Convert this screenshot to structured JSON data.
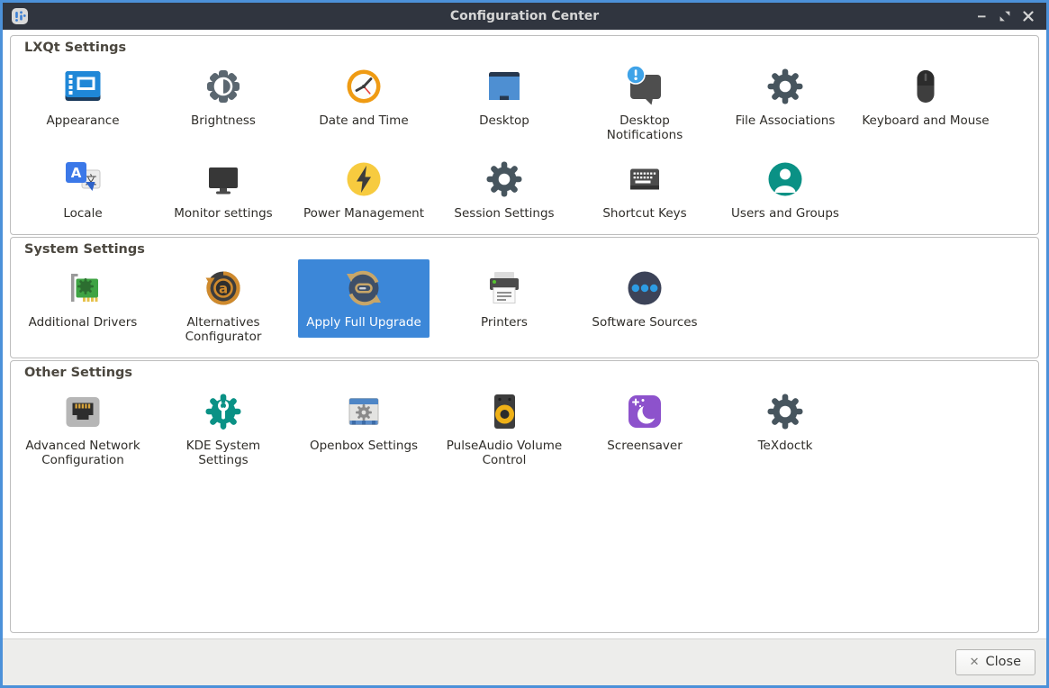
{
  "window": {
    "title": "Configuration Center",
    "app_icon": "configuration-center-icon",
    "controls": [
      {
        "name": "minimize-button",
        "icon": "minimize-icon"
      },
      {
        "name": "maximize-button",
        "icon": "maximize-icon"
      },
      {
        "name": "close-window-button",
        "icon": "close-icon"
      }
    ]
  },
  "sections": [
    {
      "title": "LXQt Settings",
      "items": [
        {
          "label": "Appearance",
          "icon": "appearance-icon",
          "selected": false
        },
        {
          "label": "Brightness",
          "icon": "brightness-icon",
          "selected": false
        },
        {
          "label": "Date and Time",
          "icon": "clock-icon",
          "selected": false
        },
        {
          "label": "Desktop",
          "icon": "desktop-icon",
          "selected": false
        },
        {
          "label": "Desktop Notifications",
          "icon": "notification-bubble-icon",
          "selected": false
        },
        {
          "label": "File Associations",
          "icon": "gear-icon",
          "selected": false
        },
        {
          "label": "Keyboard and Mouse",
          "icon": "mouse-icon",
          "selected": false
        },
        {
          "label": "Locale",
          "icon": "translate-icon",
          "selected": false
        },
        {
          "label": "Monitor settings",
          "icon": "monitor-icon",
          "selected": false
        },
        {
          "label": "Power Management",
          "icon": "power-bolt-icon",
          "selected": false
        },
        {
          "label": "Session Settings",
          "icon": "gear-icon",
          "selected": false
        },
        {
          "label": "Shortcut Keys",
          "icon": "keyboard-icon",
          "selected": false
        },
        {
          "label": "Users and Groups",
          "icon": "user-circle-icon",
          "selected": false
        }
      ]
    },
    {
      "title": "System Settings",
      "items": [
        {
          "label": "Additional Drivers",
          "icon": "pci-card-icon",
          "selected": false
        },
        {
          "label": "Alternatives Configurator",
          "icon": "alternatives-icon",
          "selected": false
        },
        {
          "label": "Apply Full Upgrade",
          "icon": "upgrade-refresh-icon",
          "selected": true
        },
        {
          "label": "Printers",
          "icon": "printer-icon",
          "selected": false
        },
        {
          "label": "Software Sources",
          "icon": "software-sources-icon",
          "selected": false
        }
      ]
    },
    {
      "title": "Other Settings",
      "items": [
        {
          "label": "Advanced Network Configuration",
          "icon": "ethernet-port-icon",
          "selected": false
        },
        {
          "label": "KDE System Settings",
          "icon": "wrench-gear-icon",
          "selected": false
        },
        {
          "label": "Openbox Settings",
          "icon": "window-gear-icon",
          "selected": false
        },
        {
          "label": "PulseAudio Volume Control",
          "icon": "speaker-icon",
          "selected": false
        },
        {
          "label": "Screensaver",
          "icon": "moon-stars-icon",
          "selected": false
        },
        {
          "label": "TeXdoctk",
          "icon": "gear-icon",
          "selected": false
        }
      ]
    }
  ],
  "footer": {
    "close_label": "Close",
    "close_icon": "✕"
  },
  "colors": {
    "frame_blue": "#4c91d9",
    "titlebar_bg": "#30353f",
    "accent_blue": "#3c87d8",
    "footer_bg": "#ededeb",
    "section_title": "#4b473f"
  }
}
